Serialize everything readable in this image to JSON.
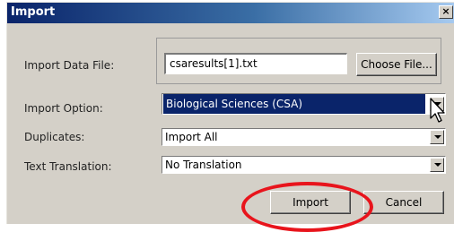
{
  "window": {
    "title": "Import",
    "close_label": "×"
  },
  "fields": {
    "import_data_file": {
      "label": "Import Data File:",
      "value": "csaresults[1].txt",
      "choose_label": "Choose File..."
    },
    "import_option": {
      "label": "Import Option:",
      "value": "Biological Sciences (CSA)"
    },
    "duplicates": {
      "label": "Duplicates:",
      "value": "Import All"
    },
    "text_translation": {
      "label": "Text Translation:",
      "value": "No Translation"
    }
  },
  "buttons": {
    "import_label": "Import",
    "cancel_label": "Cancel"
  },
  "annotation": {
    "highlight_color": "#e8141c",
    "highlight_target": "Import"
  },
  "colors": {
    "dialog_bg": "#d4d0c8",
    "selection_bg": "#0a246a"
  }
}
